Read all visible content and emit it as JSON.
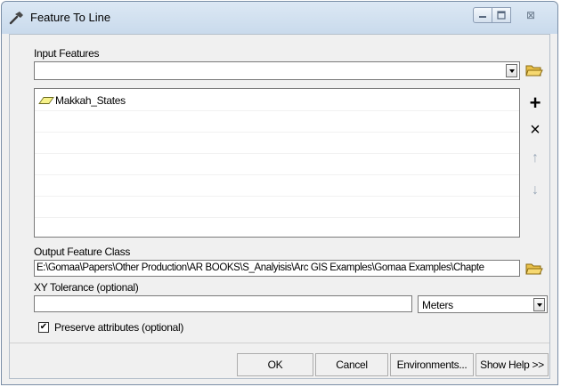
{
  "window": {
    "title": "Feature To Line",
    "title_icon": "hammer-tool-icon",
    "controls": [
      "minimize-icon",
      "maximize-icon",
      "close-icon"
    ],
    "close_glyph": "⊠"
  },
  "input_features": {
    "label": "Input Features",
    "value": "",
    "browse_icon": "open-folder-icon",
    "list_items": [
      {
        "label": "Makkah_States",
        "icon": "polygon-layer-icon"
      }
    ],
    "side_buttons": [
      {
        "name": "add-button",
        "glyph": "+",
        "icon": "plus-icon"
      },
      {
        "name": "remove-button",
        "glyph": "×",
        "icon": "x-icon"
      },
      {
        "name": "move-up-button",
        "glyph": "↑",
        "icon": "arrow-up-icon"
      },
      {
        "name": "move-down-button",
        "glyph": "↓",
        "icon": "arrow-down-icon"
      }
    ]
  },
  "output_feature_class": {
    "label": "Output Feature Class",
    "value": "E:\\Gomaa\\Papers\\Other Production\\AR BOOKS\\S_Analyisis\\Arc GIS Examples\\Gomaa Examples\\Chapte",
    "browse_icon": "open-folder-icon"
  },
  "xy_tolerance": {
    "label": "XY Tolerance (optional)",
    "value": "",
    "units_selected": "Meters"
  },
  "preserve_attributes": {
    "label": "Preserve attributes (optional)",
    "checked": true,
    "check_glyph": "✔"
  },
  "buttons": {
    "ok": "OK",
    "cancel": "Cancel",
    "environments": "Environments...",
    "show_help": "Show Help >>"
  },
  "colors": {
    "titlebar": "#c9daec",
    "folder": "#e8c04a",
    "disabled_arrow": "#9aa8b8"
  }
}
